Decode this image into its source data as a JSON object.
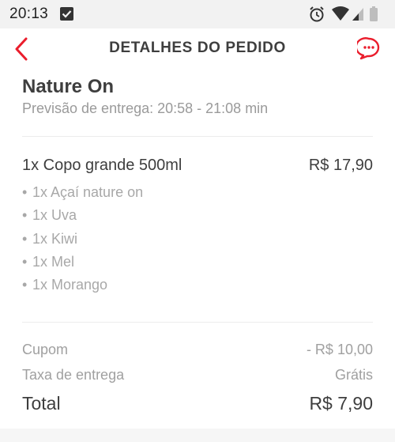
{
  "status_bar": {
    "time": "20:13",
    "icons": [
      "checkbox-notification-icon",
      "alarm-icon",
      "wifi-icon",
      "signal-icon",
      "battery-icon"
    ]
  },
  "header": {
    "title": "DETALHES DO PEDIDO",
    "accent_color": "#ea1d2c",
    "back_icon": "chevron-left-icon",
    "chat_icon": "chat-bubble-icon"
  },
  "order": {
    "store_name": "Nature On",
    "delivery_eta": "Previsão de entrega: 20:58 - 21:08 min",
    "item": {
      "title": "1x Copo grande 500ml",
      "price": "R$  17,90",
      "addons": [
        "1x Açaí nature on",
        "1x Uva",
        "1x Kiwi",
        "1x Mel",
        "1x Morango"
      ]
    }
  },
  "summary": {
    "coupon_label": "Cupom",
    "coupon_value": "- R$  10,00",
    "delivery_fee_label": "Taxa de entrega",
    "delivery_fee_value": "Grátis",
    "total_label": "Total",
    "total_value": "R$  7,90"
  }
}
